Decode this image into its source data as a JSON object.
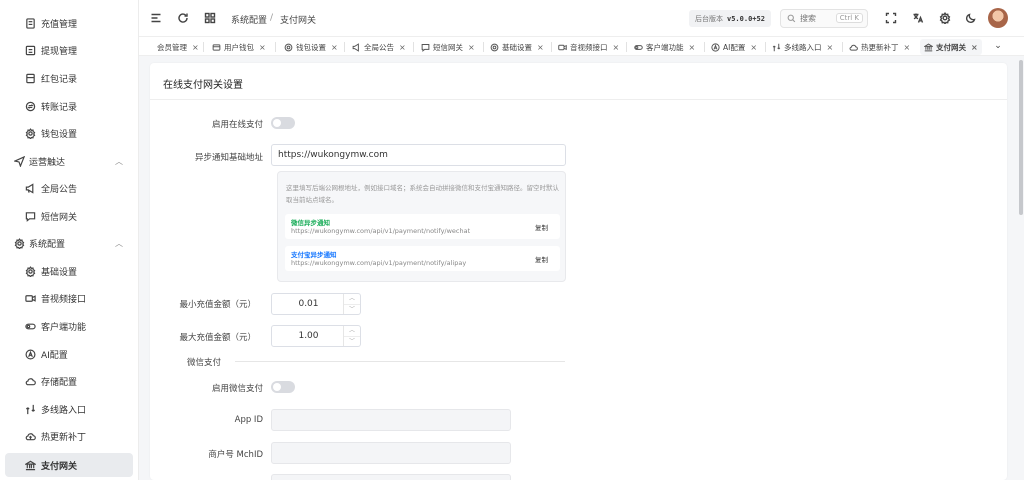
{
  "sidebar": {
    "items": [
      {
        "label": "充值管理",
        "icon": "recharge-icon"
      },
      {
        "label": "提现管理",
        "icon": "withdraw-icon"
      },
      {
        "label": "红包记录",
        "icon": "redpacket-icon"
      },
      {
        "label": "转账记录",
        "icon": "transfer-icon"
      },
      {
        "label": "钱包设置",
        "icon": "gear-icon"
      },
      {
        "label": "运营触达",
        "icon": "send-icon",
        "expanded": true
      },
      {
        "label": "全局公告",
        "icon": "megaphone-icon"
      },
      {
        "label": "短信网关",
        "icon": "sms-icon"
      },
      {
        "label": "系统配置",
        "icon": "gear-icon",
        "expanded": true
      },
      {
        "label": "基础设置",
        "icon": "gear-icon"
      },
      {
        "label": "音视频接口",
        "icon": "video-icon"
      },
      {
        "label": "客户端功能",
        "icon": "toggle-icon"
      },
      {
        "label": "AI配置",
        "icon": "ai-icon"
      },
      {
        "label": "存储配置",
        "icon": "cloud-icon"
      },
      {
        "label": "多线路入口",
        "icon": "route-icon"
      },
      {
        "label": "热更新补丁",
        "icon": "cloud-upload-icon"
      },
      {
        "label": "支付网关",
        "icon": "bank-icon",
        "active": true
      }
    ]
  },
  "header": {
    "breadcrumb_parent": "系统配置",
    "breadcrumb_sep": "/",
    "breadcrumb_current": "支付网关",
    "version_label": "后台版本",
    "version_value": "v5.0.0+52",
    "search_placeholder": "搜索",
    "search_shortcut": "Ctrl K"
  },
  "tabs": [
    {
      "label": "会员管理",
      "icon": ""
    },
    {
      "label": "用户钱包",
      "icon": "wallet-icon"
    },
    {
      "label": "钱包设置",
      "icon": "gear-icon"
    },
    {
      "label": "全局公告",
      "icon": "megaphone-icon"
    },
    {
      "label": "短信网关",
      "icon": "sms-icon"
    },
    {
      "label": "基础设置",
      "icon": "gear-icon"
    },
    {
      "label": "音视频接口",
      "icon": "video-icon"
    },
    {
      "label": "客户端功能",
      "icon": "toggle-icon"
    },
    {
      "label": "AI配置",
      "icon": "ai-icon"
    },
    {
      "label": "多线路入口",
      "icon": "route-icon"
    },
    {
      "label": "热更新补丁",
      "icon": "cloud-upload-icon"
    },
    {
      "label": "支付网关",
      "icon": "bank-icon",
      "active": true
    }
  ],
  "form": {
    "title": "在线支付网关设置",
    "enable_online_label": "启用在线支付",
    "enable_online_on": false,
    "callback_base_label": "异步通知基础地址",
    "callback_base_value": "https://wukongymw.com",
    "hint": "这里填写后端公网根地址，例如接口域名；系统会自动拼接微信和支付宝通知路径。留空时默认取当前站点域名。",
    "wechat_notify_title": "微信异步通知",
    "wechat_notify_url": "https://wukongymw.com/api/v1/payment/notify/wechat",
    "alipay_notify_title": "支付宝异步通知",
    "alipay_notify_url": "https://wukongymw.com/api/v1/payment/notify/alipay",
    "copy_label": "复制",
    "min_recharge_label": "最小充值金额（元）",
    "min_recharge_value": "0.01",
    "max_recharge_label": "最大充值金额（元）",
    "max_recharge_value": "1.00",
    "wechat_section": "微信支付",
    "enable_wechat_label": "启用微信支付",
    "enable_wechat_on": false,
    "appid_label": "App ID",
    "appid_value": "",
    "mchid_label": "商户号 MchID",
    "mchid_value": ""
  },
  "colors": {
    "wechat_green": "#1aad5a",
    "alipay_blue": "#1677ff",
    "toggle_off": "#d9dbe0",
    "active_bg": "#e9ebee"
  }
}
